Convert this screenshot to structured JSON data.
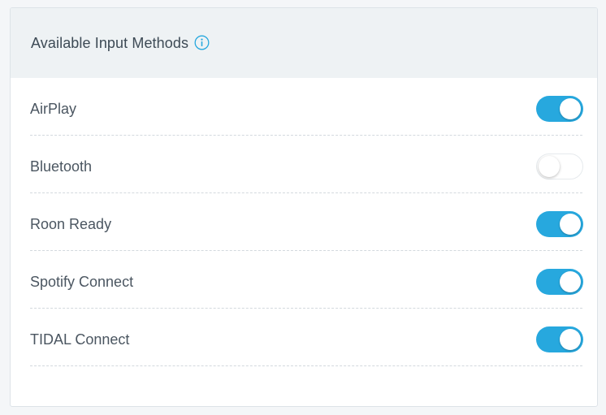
{
  "panel": {
    "title": "Available Input Methods",
    "info_icon": "info-circle-icon"
  },
  "colors": {
    "accent": "#27a8de",
    "header_bg": "#eef2f4",
    "text": "#4b5661"
  },
  "input_methods": [
    {
      "label": "AirPlay",
      "enabled": true
    },
    {
      "label": "Bluetooth",
      "enabled": false
    },
    {
      "label": "Roon Ready",
      "enabled": true
    },
    {
      "label": "Spotify Connect",
      "enabled": true
    },
    {
      "label": "TIDAL Connect",
      "enabled": true
    }
  ]
}
